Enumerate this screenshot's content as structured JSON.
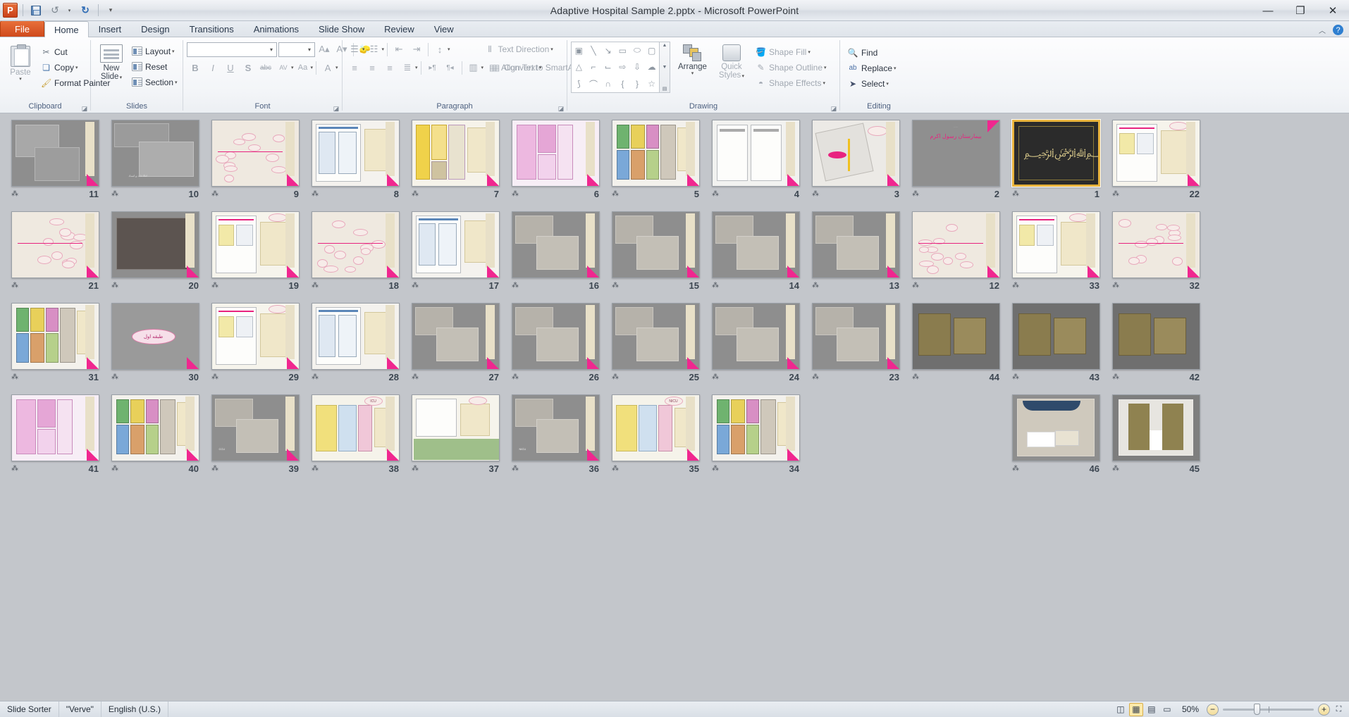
{
  "window": {
    "title": "Adaptive Hospital Sample 2.pptx  -  Microsoft PowerPoint",
    "app_logo": "powerpoint-logo",
    "minimize": "—",
    "restore": "❐",
    "close": "✕",
    "help": "?",
    "collapse_ribbon": "︿"
  },
  "qat": {
    "save": "save-icon",
    "undo": "undo-icon",
    "undo_arrow": "▾",
    "redo": "redo-icon",
    "customize": "▾"
  },
  "tabs": [
    {
      "label": "File",
      "kind": "file"
    },
    {
      "label": "Home",
      "kind": "active"
    },
    {
      "label": "Insert",
      "kind": "normal"
    },
    {
      "label": "Design",
      "kind": "normal"
    },
    {
      "label": "Transitions",
      "kind": "normal"
    },
    {
      "label": "Animations",
      "kind": "normal"
    },
    {
      "label": "Slide Show",
      "kind": "normal"
    },
    {
      "label": "Review",
      "kind": "normal"
    },
    {
      "label": "View",
      "kind": "normal"
    }
  ],
  "ribbon": {
    "groups": [
      {
        "name": "Clipboard",
        "has_dialog": true
      },
      {
        "name": "Slides",
        "has_dialog": false
      },
      {
        "name": "Font",
        "has_dialog": true
      },
      {
        "name": "Paragraph",
        "has_dialog": true
      },
      {
        "name": "Drawing",
        "has_dialog": true
      },
      {
        "name": "Editing",
        "has_dialog": false
      }
    ],
    "clipboard": {
      "paste": "Paste",
      "paste_arrow": "▾",
      "cut": "Cut",
      "copy": "Copy",
      "copy_arrow": "▾",
      "format_painter": "Format Painter"
    },
    "slides": {
      "new_slide": "New\nSlide",
      "new_slide_line1": "New",
      "new_slide_line2": "Slide",
      "new_slide_arrow": "▾",
      "layout": "Layout",
      "layout_arrow": "▾",
      "reset": "Reset",
      "section": "Section",
      "section_arrow": "▾"
    },
    "font": {
      "font_name_value": "",
      "font_size_value": "",
      "grow_font": "A▴",
      "shrink_font": "A▾",
      "clear_formatting": "clear-formatting-icon",
      "bold": "B",
      "italic": "I",
      "underline": "U",
      "shadow": "S",
      "strikethrough": "abc",
      "character_spacing": "AV",
      "change_case": "Aa",
      "font_color": "A"
    },
    "paragraph": {
      "bullets": "bullets-icon",
      "numbering": "numbering-icon",
      "decrease_indent": "decrease-indent-icon",
      "increase_indent": "increase-indent-icon",
      "line_spacing": "line-spacing-icon",
      "align_left": "align-left-icon",
      "align_center": "align-center-icon",
      "align_right": "align-right-icon",
      "justify": "justify-icon",
      "ltr": "ltr-icon",
      "rtl": "rtl-icon",
      "columns": "columns-icon",
      "text_direction": "Text Direction",
      "align_text": "Align Text",
      "convert_to_smartart": "Convert to SmartArt"
    },
    "drawing": {
      "shapes": [
        "textbox",
        "line",
        "arrow",
        "rectangle",
        "oval",
        "rounded-rect",
        "triangle",
        "elbow-connector",
        "elbow-arrow",
        "block-arrow-right",
        "block-arrow-down",
        "cloud",
        "freeform",
        "curve",
        "arc",
        "left-brace",
        "right-brace",
        "star"
      ],
      "arrange": "Arrange",
      "arrange_arrow": "▾",
      "quick_styles_line1": "Quick",
      "quick_styles_line2": "Styles",
      "quick_styles_arrow": "▾",
      "shape_fill": "Shape Fill",
      "shape_outline": "Shape Outline",
      "shape_effects": "Shape Effects"
    },
    "editing": {
      "find": "Find",
      "replace": "Replace",
      "replace_arrow": "▾",
      "select": "Select",
      "select_arrow": "▾"
    }
  },
  "sorter": {
    "selected_slide": 1,
    "transition_icon": "transition-star-icon",
    "slides": [
      {
        "number": "11",
        "style": "photo-pair",
        "label": ""
      },
      {
        "number": "10",
        "style": "photo-lobby",
        "label": "اطلاعات و اسناد"
      },
      {
        "number": "9",
        "style": "bubbles-many",
        "label": ""
      },
      {
        "number": "8",
        "style": "floorplan-blue",
        "label": ""
      },
      {
        "number": "7",
        "style": "floorplan-yellow",
        "label": ""
      },
      {
        "number": "6",
        "style": "floorplan-magenta",
        "label": ""
      },
      {
        "number": "5",
        "style": "floorplan-color",
        "label": ""
      },
      {
        "number": "4",
        "style": "floorplan-gray",
        "label": ""
      },
      {
        "number": "3",
        "style": "sitemap",
        "label": ""
      },
      {
        "number": "2",
        "style": "title-pink",
        "label": "بیمارستان رسول اکرم"
      },
      {
        "number": "1",
        "style": "calligraphy",
        "label": ""
      },
      {
        "number": "22",
        "style": "plan-notes",
        "label": ""
      },
      {
        "number": "21",
        "style": "bubbles-many",
        "label": ""
      },
      {
        "number": "20",
        "style": "photo-dark",
        "label": ""
      },
      {
        "number": "19",
        "style": "plan-notes",
        "label": ""
      },
      {
        "number": "18",
        "style": "bubbles-many",
        "label": ""
      },
      {
        "number": "17",
        "style": "floorplan-blue",
        "label": ""
      },
      {
        "number": "16",
        "style": "photo-room",
        "label": ""
      },
      {
        "number": "15",
        "style": "photo-room",
        "label": ""
      },
      {
        "number": "14",
        "style": "photo-room",
        "label": ""
      },
      {
        "number": "13",
        "style": "photo-room",
        "label": ""
      },
      {
        "number": "12",
        "style": "bubbles-many",
        "label": ""
      },
      {
        "number": "33",
        "style": "plan-notes",
        "label": ""
      },
      {
        "number": "32",
        "style": "bubbles-many",
        "label": ""
      },
      {
        "number": "31",
        "style": "floorplan-color",
        "label": ""
      },
      {
        "number": "30",
        "style": "section-divider",
        "label": "طبقه اول"
      },
      {
        "number": "29",
        "style": "plan-notes",
        "label": ""
      },
      {
        "number": "28",
        "style": "floorplan-blue",
        "label": ""
      },
      {
        "number": "27",
        "style": "photo-lab",
        "label": ""
      },
      {
        "number": "26",
        "style": "photo-lab",
        "label": ""
      },
      {
        "number": "25",
        "style": "photo-lab",
        "label": ""
      },
      {
        "number": "24",
        "style": "photo-room",
        "label": ""
      },
      {
        "number": "23",
        "style": "photo-corridor",
        "label": ""
      },
      {
        "number": "44",
        "style": "render-3d",
        "label": ""
      },
      {
        "number": "43",
        "style": "render-3d",
        "label": ""
      },
      {
        "number": "42",
        "style": "render-3d",
        "label": ""
      },
      {
        "number": "41",
        "style": "floorplan-magenta",
        "label": ""
      },
      {
        "number": "40",
        "style": "floorplan-color",
        "label": ""
      },
      {
        "number": "39",
        "style": "photo-corridor",
        "label": "CCU"
      },
      {
        "number": "38",
        "style": "floorplan-icu",
        "label": "ICU"
      },
      {
        "number": "37",
        "style": "plan-notes-green",
        "label": ""
      },
      {
        "number": "36",
        "style": "photo-corridor",
        "label": "NICU"
      },
      {
        "number": "35",
        "style": "floorplan-icu",
        "label": "NICU"
      },
      {
        "number": "34",
        "style": "floorplan-color",
        "label": ""
      },
      {
        "number": "46",
        "style": "render-room",
        "label": ""
      },
      {
        "number": "45",
        "style": "render-plan",
        "label": ""
      }
    ]
  },
  "status": {
    "view_mode": "Slide Sorter",
    "theme": "\"Verve\"",
    "language": "English (U.S.)",
    "zoom_level": "50%",
    "zoom_out": "−",
    "zoom_in": "+",
    "views": [
      {
        "name": "normal-view-button",
        "glyph": "◫",
        "active": false
      },
      {
        "name": "slide-sorter-view-button",
        "glyph": "▦",
        "active": true
      },
      {
        "name": "reading-view-button",
        "glyph": "▤",
        "active": false
      },
      {
        "name": "slide-show-button",
        "glyph": "▭",
        "active": false
      }
    ],
    "fit_to_window": "fit-slide-to-window-icon"
  }
}
